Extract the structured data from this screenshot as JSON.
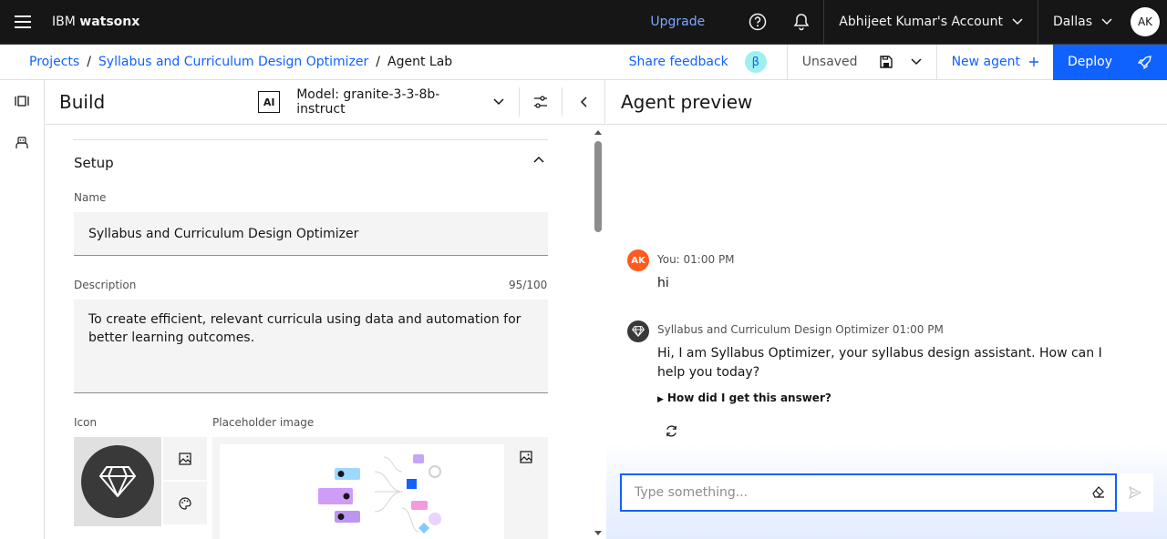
{
  "topbar": {
    "brand_prefix": "IBM",
    "brand_name": "watsonx",
    "upgrade": "Upgrade",
    "account": "Abhijeet Kumar's Account",
    "region": "Dallas",
    "avatar_initials": "AK"
  },
  "breadcrumb": {
    "items": [
      "Projects",
      "Syllabus and Curriculum Design Optimizer",
      "Agent Lab"
    ],
    "separator": "/"
  },
  "subbar": {
    "share_feedback": "Share feedback",
    "beta": "β",
    "status": "Unsaved",
    "new_agent": "New agent",
    "deploy": "Deploy"
  },
  "build": {
    "title": "Build",
    "ai_badge": "AI",
    "model": "Model: granite-3-3-8b-instruct",
    "setup_title": "Setup",
    "name_label": "Name",
    "name_value": "Syllabus and Curriculum Design Optimizer",
    "description_label": "Description",
    "description_count": "95/100",
    "description_value": "To create efficient, relevant curricula using data and automation for better learning outcomes.",
    "icon_label": "Icon",
    "placeholder_label": "Placeholder image"
  },
  "preview": {
    "title": "Agent preview",
    "user_avatar": "AK",
    "user_meta": "You: 01:00 PM",
    "user_message": "hi",
    "agent_meta": "Syllabus and Curriculum Design Optimizer 01:00 PM",
    "agent_message": "Hi, I am Syllabus Optimizer, your syllabus design assistant. How can I help you today?",
    "how_answer": "How did I get this answer?",
    "input_placeholder": "Type something..."
  },
  "colors": {
    "topbar_bg": "#161616",
    "accent": "#0f62fe",
    "user_avatar": "#ff5a1f",
    "beta_bg": "#9ef0f0"
  },
  "icons": [
    "menu-icon",
    "help-icon",
    "notification-icon",
    "chevron-down-icon",
    "save-icon",
    "plus-icon",
    "rocket-icon",
    "panel-icon",
    "agent-icon",
    "settings-sliders-icon",
    "chevron-left-icon",
    "chevron-up-icon",
    "image-icon",
    "palette-icon",
    "diamond-icon",
    "refresh-icon",
    "eraser-icon",
    "send-icon"
  ]
}
